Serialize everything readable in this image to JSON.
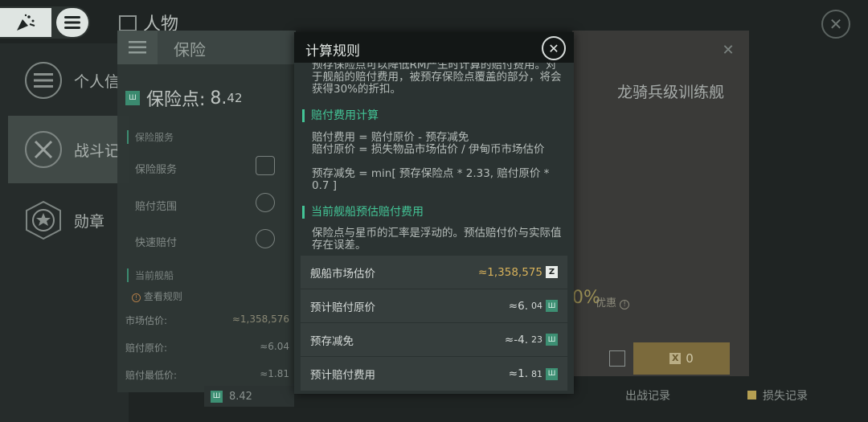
{
  "topbar": {
    "title": "人物"
  },
  "nav": [
    {
      "label": "个人信"
    },
    {
      "label": "战斗记"
    },
    {
      "label": "勋章"
    }
  ],
  "insurance": {
    "title": "保险",
    "points_label": "保险点:",
    "points_int": "8.",
    "points_dec": "42",
    "services_header": "保险服务",
    "rows": [
      {
        "label": "保险服务"
      },
      {
        "label": "赔付范围"
      },
      {
        "label": "快速赔付"
      }
    ],
    "current_ship_header": "当前舰船",
    "view_rules": "查看规则",
    "mini_rows": [
      {
        "label": "市场估价:",
        "value": "≈1,358,576"
      },
      {
        "label": "赔付原价:",
        "value": "≈6.04"
      },
      {
        "label": "赔付最低价:",
        "value": "≈1.81"
      }
    ],
    "bottom_value": "8.42"
  },
  "ship": {
    "title": "龙骑兵级训练舰",
    "discount": "0%",
    "discount_sub": "优惠",
    "button_value": "0",
    "left_bottom_link": "出战记录",
    "right_bottom_link": "损失记录"
  },
  "dialog": {
    "title": "计算规则",
    "intro": "预存保险点可以降低RM产生时计算的赔付费用。对于舰船的赔付费用，被预存保险点覆盖的部分，将会获得30%的折扣。",
    "section1_title": "赔付费用计算",
    "formula1": "赔付费用 = 赔付原价 - 预存减免",
    "formula2": "赔付原价 = 损失物品市场估价 / 伊甸币市场估价",
    "formula3": "预存减免 = min[ 预存保险点 * 2.33, 赔付原价 * 0.7 ]",
    "section2_title": "当前舰船预估赔付费用",
    "note": "保险点与星币的汇率是浮动的。预估赔付价与实际值存在误差。",
    "table": [
      {
        "label": "舰船市场估价",
        "value": "≈1,358,575",
        "dec": "",
        "icon": "z"
      },
      {
        "label": "预计赔付原价",
        "value": "≈6.",
        "dec": "04",
        "icon": "g"
      },
      {
        "label": "预存减免",
        "value": "≈-4.",
        "dec": "23",
        "icon": "g"
      },
      {
        "label": "预计赔付费用",
        "value": "≈1.",
        "dec": "81",
        "icon": "g"
      }
    ]
  },
  "colors": {
    "accent": "#43c496",
    "gold": "#d8b25b",
    "dialog_bg": "#2b3332"
  }
}
